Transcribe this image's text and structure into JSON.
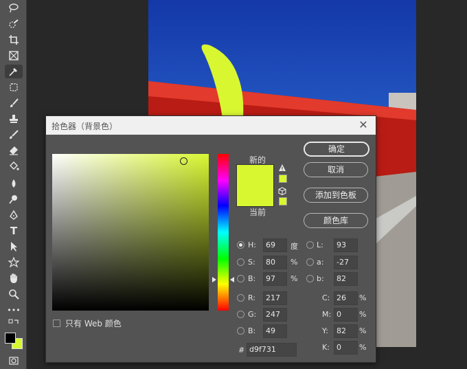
{
  "toolbar": {
    "icons": [
      "lasso-icon",
      "quick-select-icon",
      "crop-icon",
      "frame-icon",
      "eyedropper-icon",
      "spot-healing-icon",
      "brush-icon",
      "clone-stamp-icon",
      "history-brush-icon",
      "eraser-icon",
      "paint-bucket-icon",
      "blur-icon",
      "dodge-icon",
      "pen-icon",
      "type-icon",
      "path-select-icon",
      "shape-icon",
      "hand-icon",
      "zoom-icon",
      "more-icon"
    ],
    "type_glyph": "T",
    "more_glyph": "•••",
    "fg_color": "#000000",
    "bg_color": "#d9f731"
  },
  "dialog": {
    "title": "拾色器（背景色）",
    "close_glyph": "✕",
    "label_new": "新的",
    "label_current": "当前",
    "new_color": "#d9f731",
    "current_color": "#d9f731",
    "buttons": {
      "ok": "确定",
      "cancel": "取消",
      "add_to_swatches": "添加到色板",
      "color_libraries": "颜色库"
    },
    "hsb": [
      {
        "label": "H:",
        "value": "69",
        "unit": "度",
        "checked": true
      },
      {
        "label": "S:",
        "value": "80",
        "unit": "%",
        "checked": false
      },
      {
        "label": "B:",
        "value": "97",
        "unit": "%",
        "checked": false
      }
    ],
    "rgb": [
      {
        "label": "R:",
        "value": "217"
      },
      {
        "label": "G:",
        "value": "247"
      },
      {
        "label": "B:",
        "value": "49"
      }
    ],
    "lab": [
      {
        "label": "L:",
        "value": "93"
      },
      {
        "label": "a:",
        "value": "-27"
      },
      {
        "label": "b:",
        "value": "82"
      }
    ],
    "cmyk": [
      {
        "label": "C:",
        "value": "26",
        "unit": "%"
      },
      {
        "label": "M:",
        "value": "0",
        "unit": "%"
      },
      {
        "label": "Y:",
        "value": "82",
        "unit": "%"
      },
      {
        "label": "K:",
        "value": "0",
        "unit": "%"
      }
    ],
    "hex_label": "#",
    "hex_value": "d9f731",
    "web_only_label": "只有 Web 颜色"
  }
}
